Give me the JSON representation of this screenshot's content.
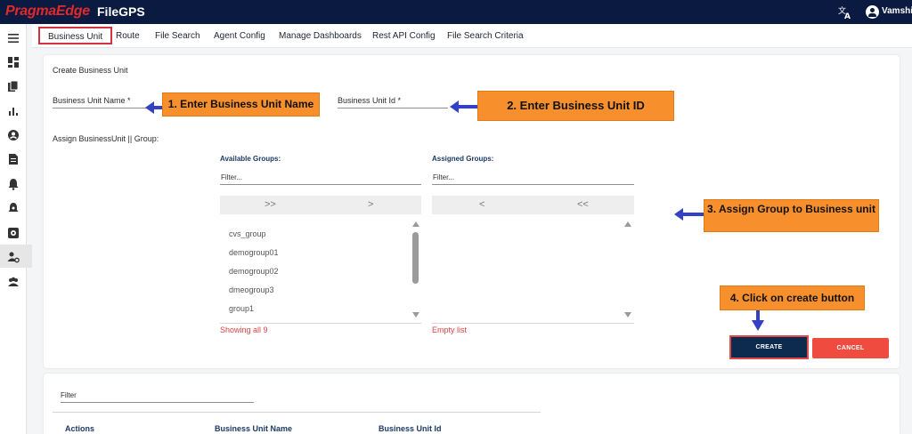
{
  "header": {
    "brand": "PragmaEdge",
    "product": "FileGPS",
    "user": "Vamshi"
  },
  "tabs": [
    {
      "label": "Business Unit"
    },
    {
      "label": "Route"
    },
    {
      "label": "File Search"
    },
    {
      "label": "Agent Config"
    },
    {
      "label": "Manage Dashboards"
    },
    {
      "label": "Rest API Config"
    },
    {
      "label": "File Search Criteria"
    }
  ],
  "form": {
    "title": "Create Business Unit",
    "name_label": "Business Unit Name *",
    "id_label": "Business Unit Id *",
    "assign_label": "Assign BusinessUnit || Group:"
  },
  "available": {
    "title": "Available Groups:",
    "filter_placeholder": "Filter...",
    "move_all": ">>",
    "move_one": ">",
    "items": [
      "cvs_group",
      "demogroup01",
      "demogroup02",
      "dmeogroup3",
      "group1"
    ],
    "status": "Showing all 9"
  },
  "assigned": {
    "title": "Assigned Groups:",
    "filter_placeholder": "Filter...",
    "remove_one": "<",
    "remove_all": "<<",
    "status": "Empty list"
  },
  "buttons": {
    "create": "CREATE",
    "cancel": "CANCEL"
  },
  "callouts": {
    "step1": "1. Enter Business Unit Name",
    "step2": "2. Enter Business Unit ID",
    "step3": "3. Assign Group to Business unit",
    "step4": "4. Click on create button"
  },
  "table": {
    "filter_label": "Filter",
    "columns": [
      "Actions",
      "Business Unit Name",
      "Business Unit Id"
    ]
  },
  "colors": {
    "nav": "#0b1a40",
    "accent_red": "#d2333f",
    "callout": "#f7902c",
    "arrow": "#3341c4",
    "create": "#0d2a4f",
    "cancel": "#f04b3f"
  }
}
